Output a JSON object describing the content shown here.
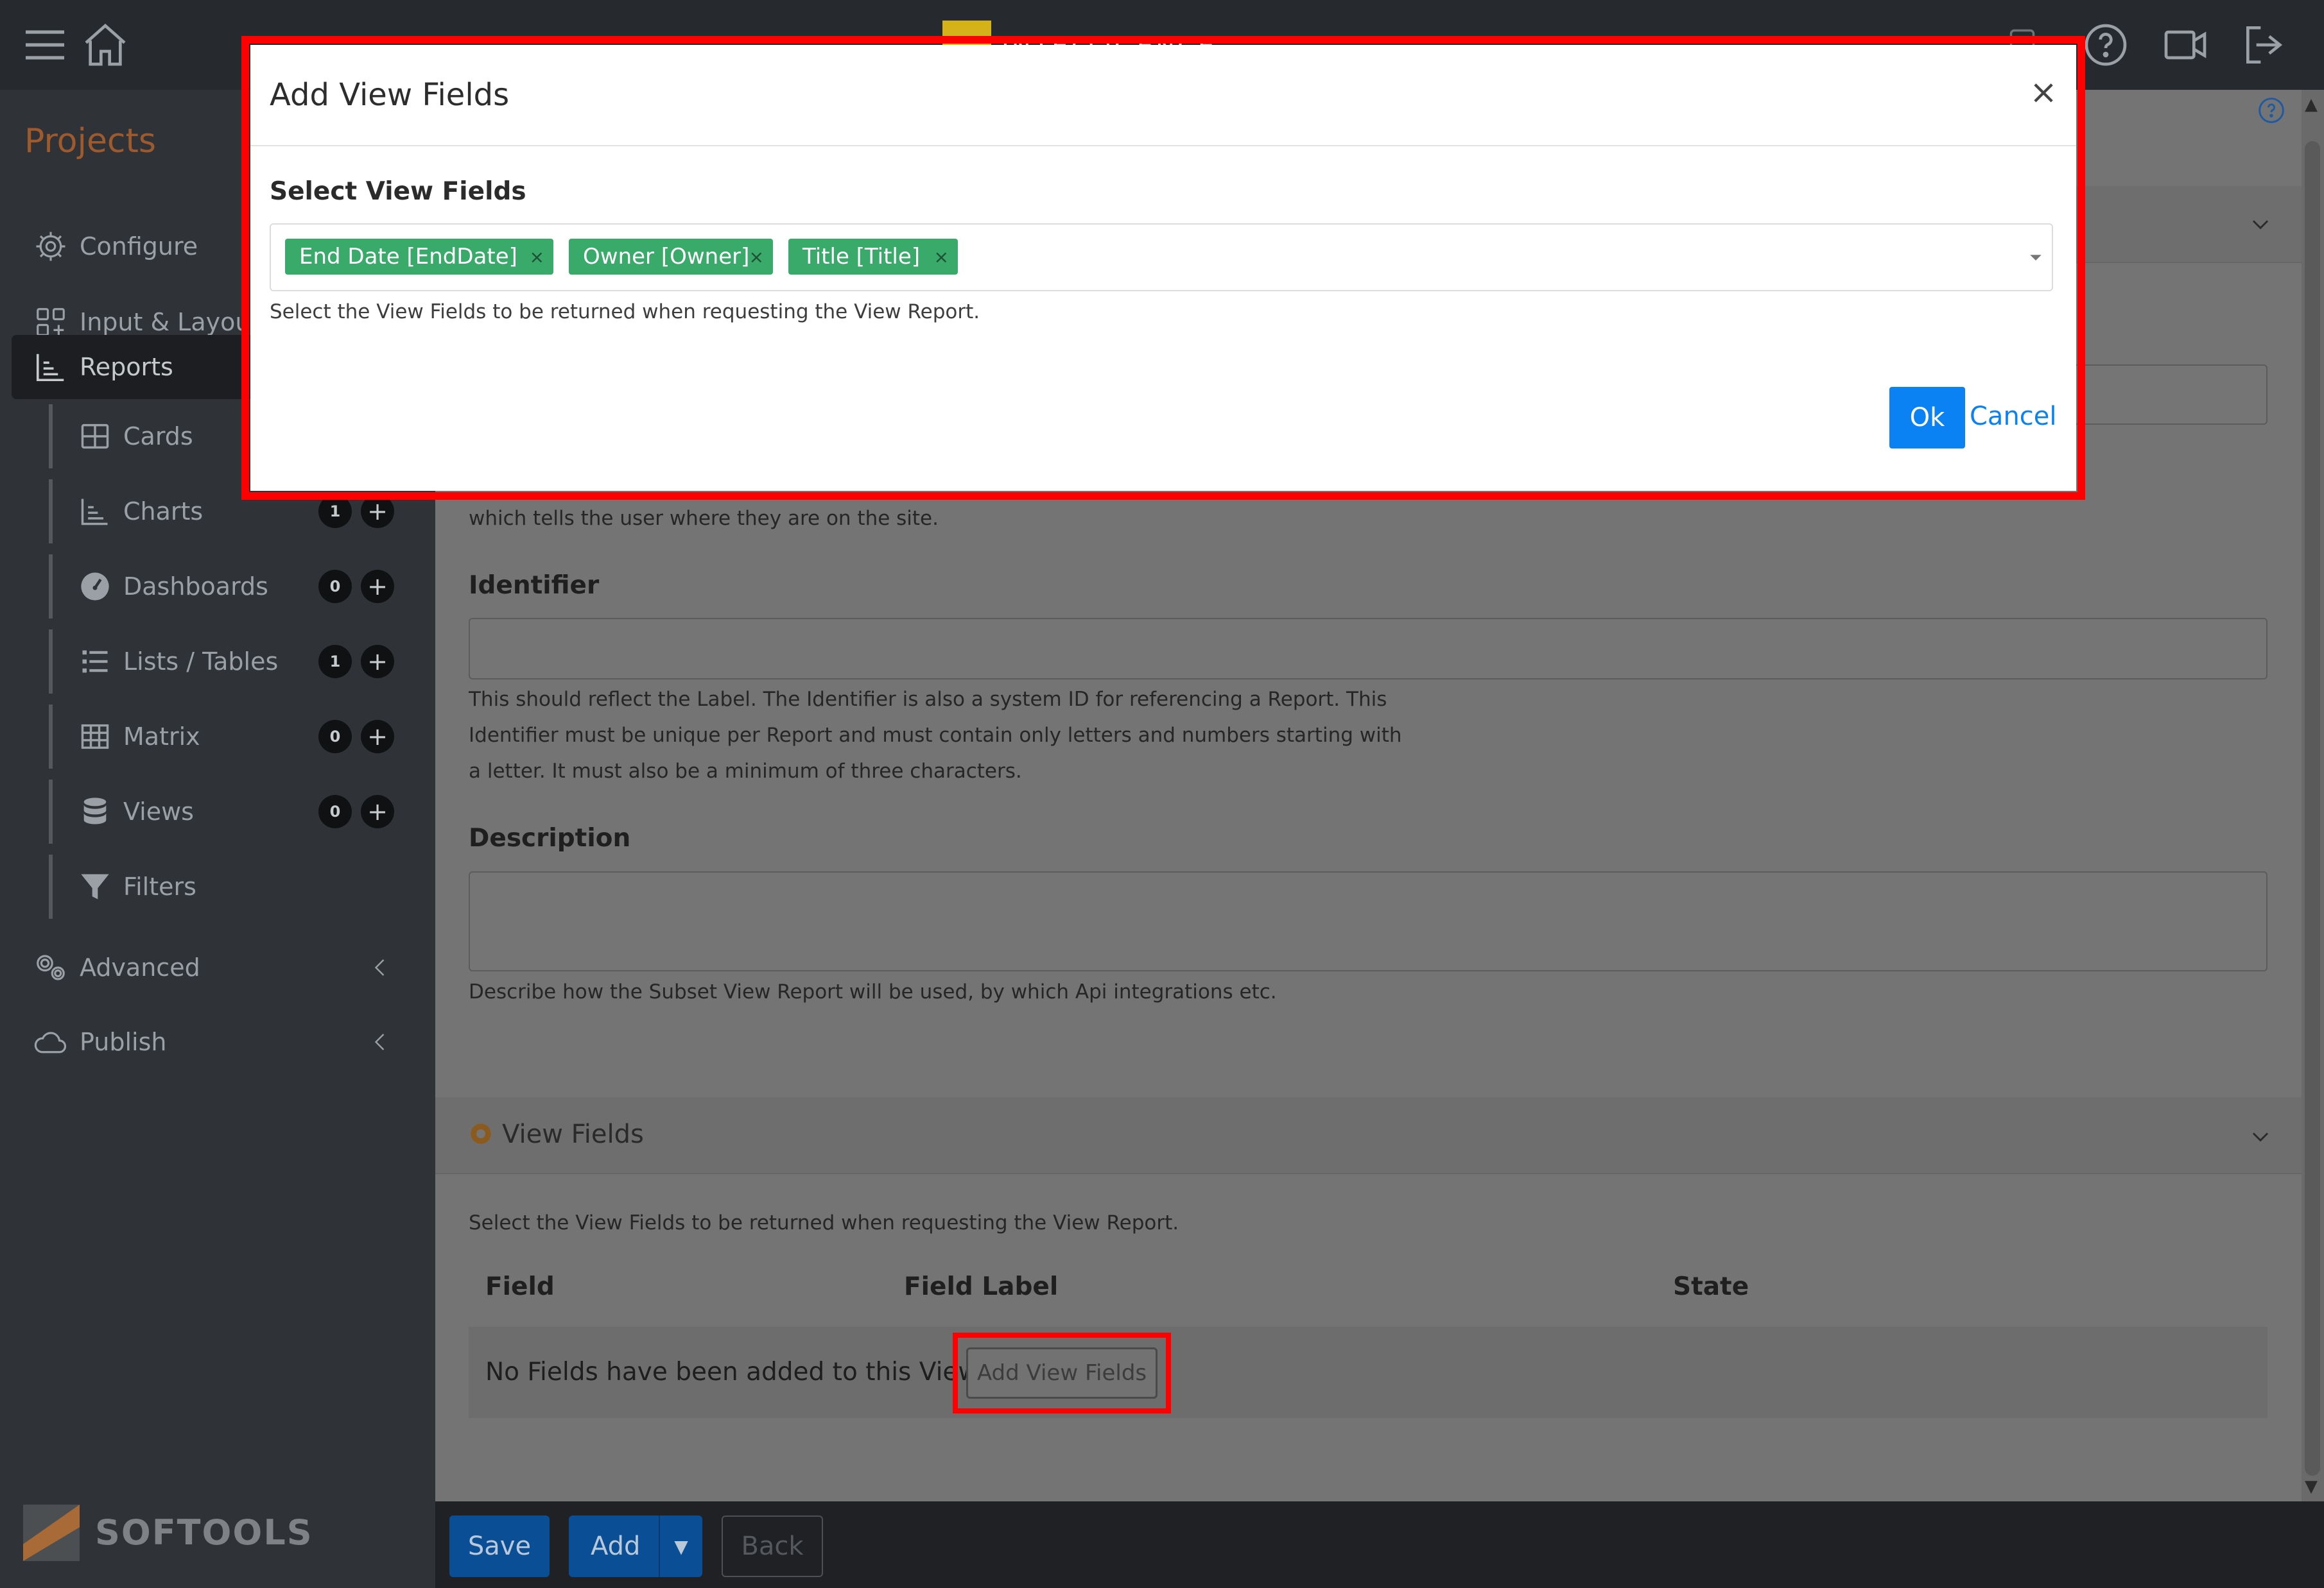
{
  "topbar": {
    "brand_text": "INTELLIGENCE",
    "colors": {
      "brand_yellow": "#d6b21a",
      "brand_orange": "#c2571c"
    }
  },
  "sidebar": {
    "section_title": "Projects",
    "items": [
      {
        "label": "Configure",
        "icon": "gear-icon"
      },
      {
        "label": "Input & Layout",
        "icon": "layout-icon"
      },
      {
        "label": "Reports",
        "icon": "bar-chart-icon",
        "active": true
      },
      {
        "label": "Advanced",
        "icon": "gears-icon"
      },
      {
        "label": "Publish",
        "icon": "cloud-icon"
      }
    ],
    "report_items": [
      {
        "label": "Cards",
        "icon": "cards-icon"
      },
      {
        "label": "Charts",
        "icon": "chart-icon",
        "count": "1"
      },
      {
        "label": "Dashboards",
        "icon": "gauge-icon",
        "count": "0"
      },
      {
        "label": "Lists / Tables",
        "icon": "list-icon",
        "count": "1"
      },
      {
        "label": "Matrix",
        "icon": "grid-icon",
        "count": "0"
      },
      {
        "label": "Views",
        "icon": "database-icon",
        "count": "0"
      },
      {
        "label": "Filters",
        "icon": "filter-icon"
      }
    ],
    "logo_text": "SOFTOOLS"
  },
  "main": {
    "breadcrumb_help": "which tells the user where they are on the site.",
    "identifier": {
      "label": "Identifier",
      "help_lines": [
        "This should reflect the Label. The Identifier is also a system ID for referencing a Report. This",
        "Identifier must be unique per Report and must contain only letters and numbers starting with",
        "a letter. It must also be a minimum of three characters."
      ]
    },
    "description": {
      "label": "Description",
      "help": "Describe how the Subset View Report will be used, by which Api integrations etc."
    },
    "view_fields_panel": {
      "title": "View Fields",
      "help": "Select the View Fields to be returned when requesting the View Report.",
      "columns": [
        "Field",
        "Field Label",
        "State"
      ],
      "empty_message": "No Fields have been added to this View",
      "add_button": "Add View Fields"
    }
  },
  "bottombar": {
    "save": "Save",
    "add": "Add",
    "back": "Back"
  },
  "modal": {
    "title": "Add View Fields",
    "close": "×",
    "select_label": "Select View Fields",
    "chips": [
      {
        "label": "End Date [EndDate]"
      },
      {
        "label": "Owner [Owner]"
      },
      {
        "label": "Title [Title]"
      }
    ],
    "chip_remove": "×",
    "help": "Select the View Fields to be returned when requesting the View Report.",
    "ok": "Ok",
    "cancel": "Cancel",
    "colors": {
      "chip": "#3aaa6a",
      "primary": "#0a82f3",
      "highlight": "#ff0000"
    }
  }
}
